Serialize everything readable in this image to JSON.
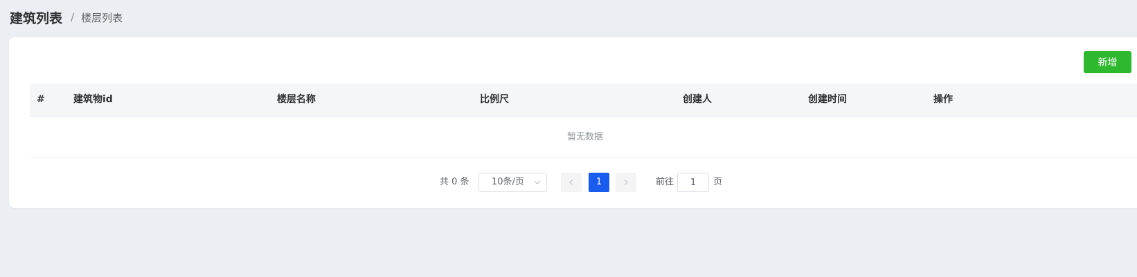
{
  "breadcrumb": {
    "root": "建筑列表",
    "separator": "/",
    "current": "楼层列表"
  },
  "toolbar": {
    "add_label": "新增",
    "add_color": "#2eb82e"
  },
  "table": {
    "columns": [
      "#",
      "建筑物id",
      "楼层名称",
      "比例尺",
      "创建人",
      "创建时间",
      "操作"
    ],
    "rows": [],
    "empty_text": "暂无数据"
  },
  "pagination": {
    "total_text": "共 0 条",
    "page_size": "10条/页",
    "current_page": "1",
    "goto_label": "前往",
    "goto_value": "1",
    "page_label": "页",
    "active_color": "#1a5cf0",
    "prev_icon": "chevron-left-icon",
    "next_icon": "chevron-right-icon",
    "select_icon": "chevron-down-icon"
  },
  "colors": {
    "background": "#ebeef2",
    "card": "#ffffff",
    "header_bg": "#f5f6f7"
  }
}
